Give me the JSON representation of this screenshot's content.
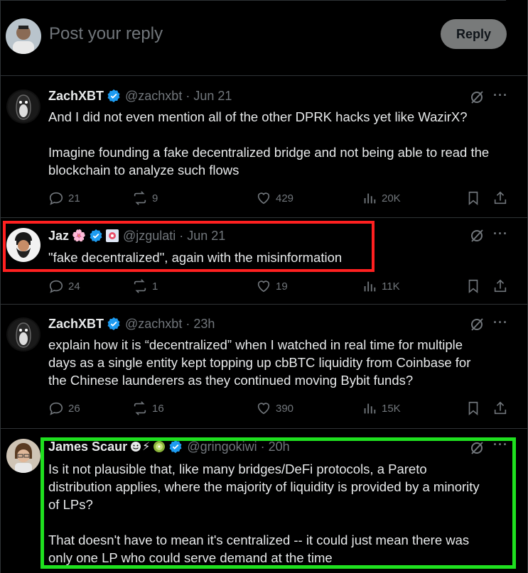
{
  "compose": {
    "placeholder": "Post your reply",
    "reply_label": "Reply"
  },
  "tweets": [
    {
      "name": "ZachXBT",
      "handle": "@zachxbt · Jun 21",
      "text": "And I did not even mention all of the other DPRK hacks yet like WazirX?\n\nImagine founding a fake decentralized bridge and not being able to read the\nblockchain to analyze such flows",
      "replies": "21",
      "reposts": "9",
      "likes": "429",
      "views": "20K"
    },
    {
      "name": "Jaz",
      "handle": "@jzgulati · Jun 21",
      "emoji": "🌸",
      "text": "\"fake decentralized\", again with the misinformation",
      "replies": "24",
      "reposts": "1",
      "likes": "19",
      "views": "11K"
    },
    {
      "name": "ZachXBT",
      "handle": "@zachxbt · 23h",
      "text": "explain how it is “decentralized” when I watched in real time for multiple\ndays as a single entity kept topping up cbBTC liquidity from Coinbase for\nthe Chinese launderers as they continued moving Bybit funds?",
      "replies": "26",
      "reposts": "16",
      "likes": "390",
      "views": "15K"
    },
    {
      "name": "James Scaur",
      "handle": "@gringokiwi · 20h",
      "emoji": "⚡",
      "text": "Is it not plausible that, like many bridges/DeFi protocols, a Pareto\ndistribution applies, where the majority of liquidity is provided by a minority\nof LPs?\n\nThat doesn't have to mean it's centralized -- it could just mean there was\nonly one LP who could serve demand at the time"
    }
  ],
  "colors": {
    "background": "#000000",
    "text": "#e7e9ea",
    "muted": "#71767b",
    "verified": "#1d9bf0",
    "highlight_red": "#ff2020",
    "highlight_green": "#1fe01f"
  }
}
